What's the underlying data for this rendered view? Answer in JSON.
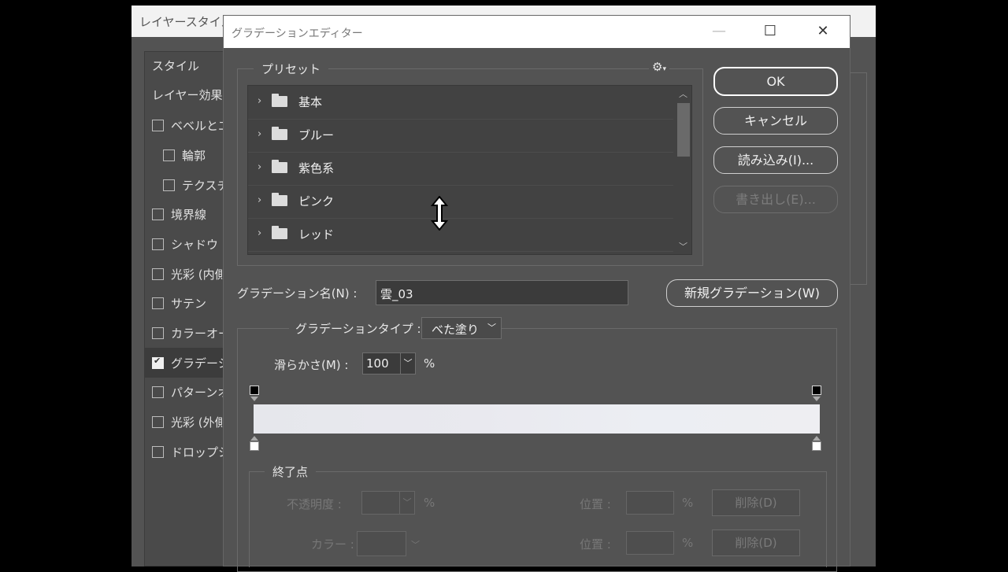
{
  "layer_style_dialog": {
    "title": "レイヤースタイル",
    "sidebar": [
      {
        "label": "スタイル",
        "type": "header"
      },
      {
        "label": "レイヤー効果",
        "type": "header"
      },
      {
        "label": "ベベルとエンボス",
        "checked": false
      },
      {
        "label": "輪郭",
        "checked": false,
        "sub": true
      },
      {
        "label": "テクスチャ",
        "checked": false,
        "sub": true
      },
      {
        "label": "境界線",
        "checked": false
      },
      {
        "label": "シャドウ (内側)",
        "checked": false
      },
      {
        "label": "光彩 (内側)",
        "checked": false
      },
      {
        "label": "サテン",
        "checked": false
      },
      {
        "label": "カラーオーバーレイ",
        "checked": false
      },
      {
        "label": "グラデーションオーバーレイ",
        "checked": true
      },
      {
        "label": "パターンオーバーレイ",
        "checked": false
      },
      {
        "label": "光彩 (外側)",
        "checked": false
      },
      {
        "label": "ドロップシャドウ",
        "checked": false
      }
    ]
  },
  "gradient_editor": {
    "title": "グラデーションエディター",
    "window_buttons": {
      "minimize": "—",
      "maximize": "☐",
      "close": "✕"
    },
    "presets": {
      "label": "プリセット",
      "items": [
        "基本",
        "ブルー",
        "紫色系",
        "ピンク",
        "レッド"
      ]
    },
    "buttons": {
      "ok": "OK",
      "cancel": "キャンセル",
      "load": "読み込み(I)...",
      "save": "書き出し(E)...",
      "new_gradient": "新規グラデーション(W)"
    },
    "name_label": "グラデーション名(N) :",
    "name_value": "雲_03",
    "type_label": "グラデーションタイプ :",
    "type_value": "べた塗り",
    "smoothness_label": "滑らかさ(M) :",
    "smoothness_value": "100",
    "smoothness_unit": "%",
    "stops_group": {
      "label": "終了点",
      "opacity_label": "不透明度 :",
      "opacity_unit": "%",
      "location_label": "位置 :",
      "location_unit": "%",
      "delete_label": "削除(D)",
      "color_label": "カラー :"
    },
    "colors": {
      "accent_border": "#ffffff",
      "background": "#535353"
    }
  }
}
